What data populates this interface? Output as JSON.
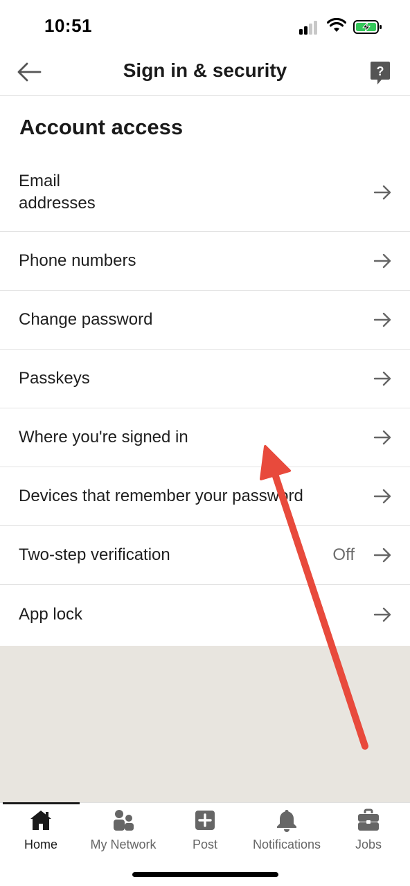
{
  "status_bar": {
    "time": "10:51"
  },
  "header": {
    "title": "Sign in & security"
  },
  "section": {
    "title": "Account access"
  },
  "items": [
    {
      "label": "Email addresses",
      "value": ""
    },
    {
      "label": "Phone numbers",
      "value": ""
    },
    {
      "label": "Change password",
      "value": ""
    },
    {
      "label": "Passkeys",
      "value": ""
    },
    {
      "label": "Where you're signed in",
      "value": ""
    },
    {
      "label": "Devices that remember your password",
      "value": ""
    },
    {
      "label": "Two-step verification",
      "value": "Off"
    },
    {
      "label": "App lock",
      "value": ""
    }
  ],
  "tabs": [
    {
      "label": "Home",
      "icon": "home-icon",
      "active": true
    },
    {
      "label": "My Network",
      "icon": "people-icon",
      "active": false
    },
    {
      "label": "Post",
      "icon": "plus-square-icon",
      "active": false
    },
    {
      "label": "Notifications",
      "icon": "bell-icon",
      "active": false
    },
    {
      "label": "Jobs",
      "icon": "briefcase-icon",
      "active": false
    }
  ],
  "colors": {
    "annotation_arrow": "#e84a3c",
    "battery": "#34c759",
    "background_fill": "#e8e5df"
  }
}
